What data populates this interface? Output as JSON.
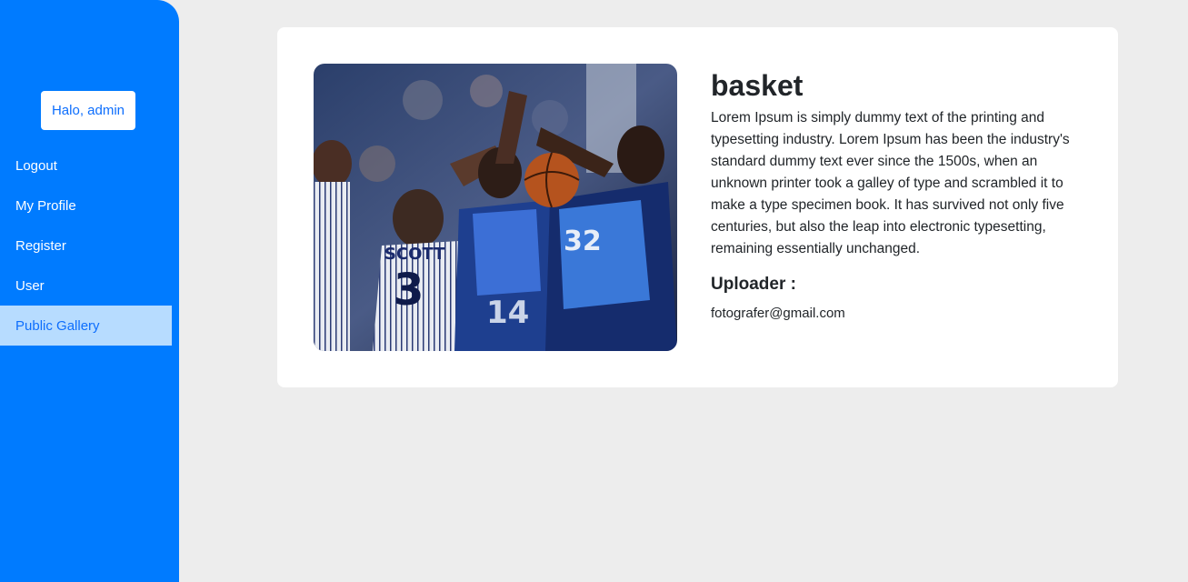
{
  "sidebar": {
    "greeting": "Halo, admin",
    "items": [
      {
        "label": "Logout"
      },
      {
        "label": "My Profile"
      },
      {
        "label": "Register"
      },
      {
        "label": "User"
      },
      {
        "label": "Public Gallery",
        "active": true
      }
    ]
  },
  "photo": {
    "title": "basket",
    "description": "Lorem Ipsum is simply dummy text of the printing and typesetting industry. Lorem Ipsum has been the industry's standard dummy text ever since the 1500s, when an unknown printer took a galley of type and scrambled it to make a type specimen book. It has survived not only five centuries, but also the leap into electronic typesetting, remaining essentially unchanged.",
    "uploader_label": "Uploader :",
    "uploader_email": "fotografer@gmail.com",
    "jersey_name": "SCOTT",
    "jersey_numbers": [
      "3",
      "32",
      "14"
    ]
  },
  "colors": {
    "sidebar": "#007bff",
    "active_item_bg": "#b7dcff",
    "page_bg": "#ededed",
    "link_blue": "#0d6efd"
  }
}
